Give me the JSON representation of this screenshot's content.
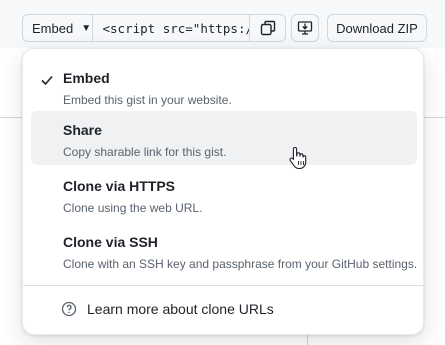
{
  "toolbar": {
    "embed_select_label": "Embed",
    "embed_code": "<script src=\"https:/",
    "download_zip_label": "Download ZIP"
  },
  "menu": {
    "items": [
      {
        "label": "Embed",
        "description": "Embed this gist in your website.",
        "selected": true
      },
      {
        "label": "Share",
        "description": "Copy sharable link for this gist.",
        "selected": false
      },
      {
        "label": "Clone via HTTPS",
        "description": "Clone using the web URL.",
        "selected": false
      },
      {
        "label": "Clone via SSH",
        "description": "Clone with an SSH key and passphrase from your GitHub settings.",
        "selected": false
      }
    ],
    "learn_more": "Learn more about clone URLs"
  },
  "icons": {
    "embed_caret": "triangle-down-icon",
    "copy": "copy-icon",
    "desktop": "desktop-download-icon",
    "selected": "check-icon",
    "help": "question-icon",
    "cursor": "hand-pointer-icon"
  },
  "colors": {
    "hover_background": "#eff1f3",
    "text_primary": "#1f2328",
    "text_muted": "#59636e"
  }
}
